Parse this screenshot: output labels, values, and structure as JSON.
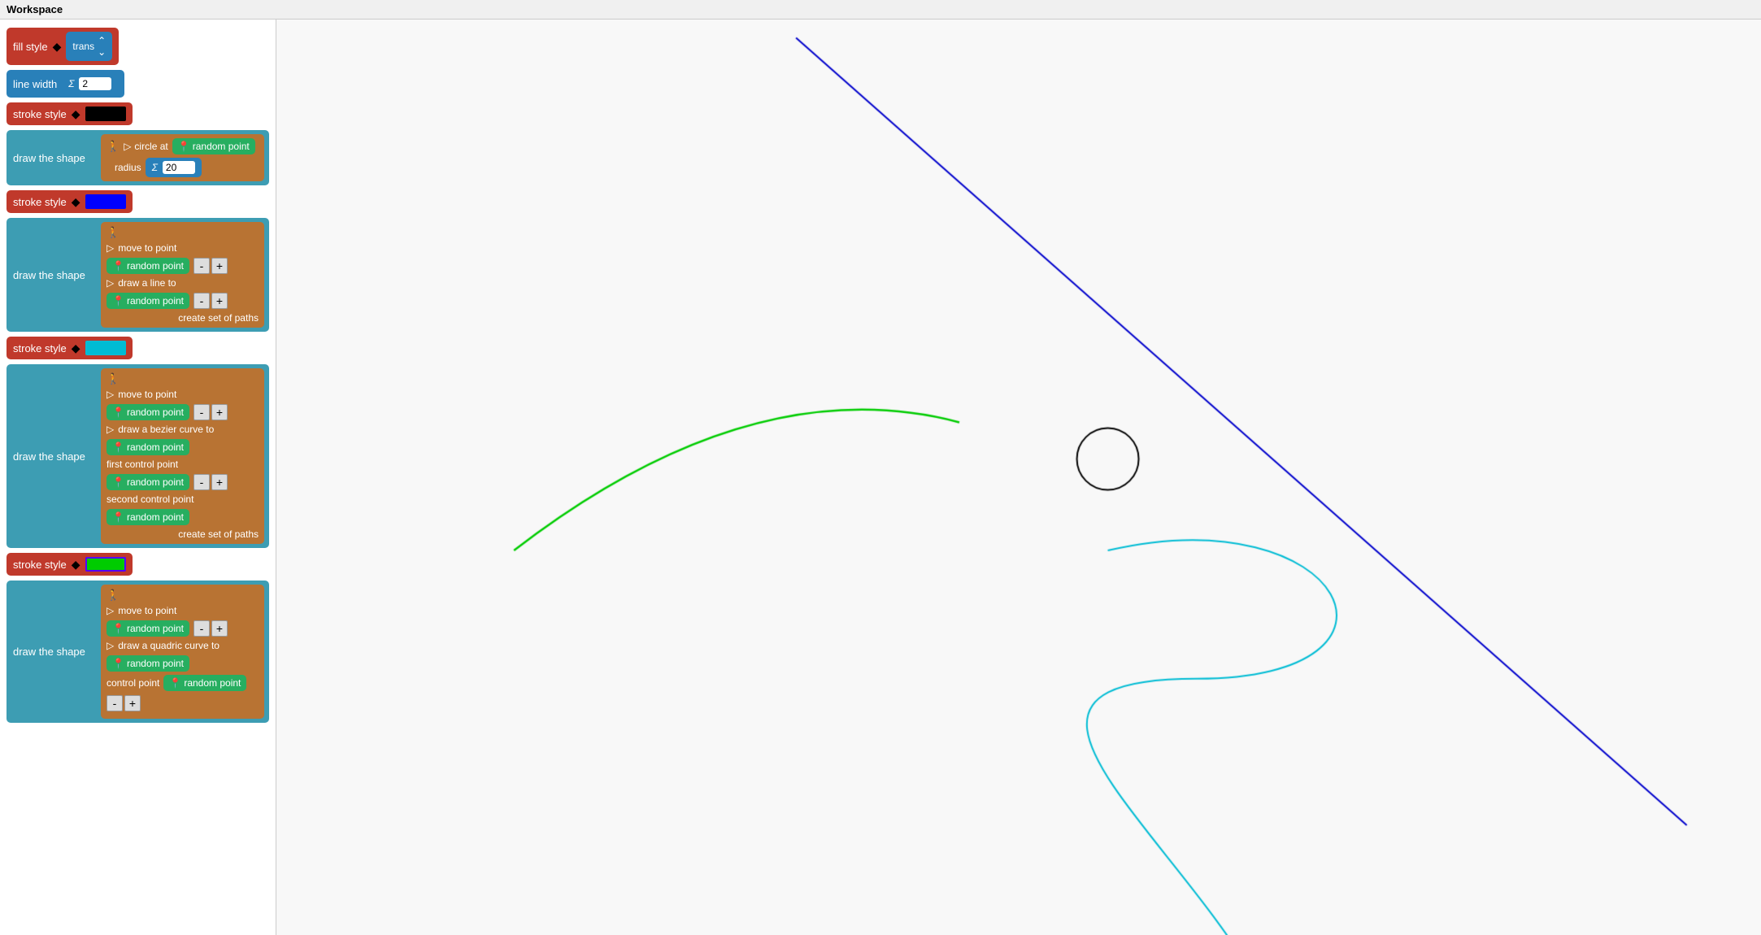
{
  "title": "Workspace",
  "left_panel": {
    "fill_style": {
      "label": "fill style",
      "icon": "diamond-icon",
      "value": "trans"
    },
    "line_width": {
      "label": "line width",
      "sigma": "Σ",
      "value": "2"
    },
    "stroke_style_1": {
      "label": "stroke style",
      "icon": "diamond-icon",
      "color": "black"
    },
    "draw_shape_1": {
      "label": "draw the shape",
      "circle_label": "circle at",
      "random_point": "random point",
      "radius_label": "radius",
      "sigma": "Σ",
      "radius_value": "20"
    },
    "stroke_style_2": {
      "label": "stroke style",
      "icon": "diamond-icon",
      "color": "blue"
    },
    "draw_shape_2": {
      "label": "draw the shape",
      "path1_label": "move to point",
      "path1_point": "random point",
      "path2_label": "draw a line to",
      "path2_point": "random point",
      "set_label": "create set of paths"
    },
    "stroke_style_3": {
      "label": "stroke style",
      "icon": "diamond-icon",
      "color": "cyan"
    },
    "draw_shape_3": {
      "label": "draw the shape",
      "path1_label": "move to point",
      "path1_point": "random point",
      "path2_label": "draw a bezier curve to",
      "path2_point": "random point",
      "ctrl1_label": "first control point",
      "ctrl1_point": "random point",
      "ctrl2_label": "second control point",
      "ctrl2_point": "random point",
      "set_label": "create set of paths"
    },
    "stroke_style_4": {
      "label": "stroke style",
      "icon": "diamond-icon",
      "color": "green"
    },
    "draw_shape_4": {
      "label": "draw the shape",
      "path1_label": "move to point",
      "path1_point": "random point",
      "path2_label": "draw a quadric curve to",
      "path2_point": "random point",
      "ctrl_label": "control point",
      "ctrl_point": "random point"
    }
  },
  "canvas": {
    "bg": "#f8f8f8"
  }
}
